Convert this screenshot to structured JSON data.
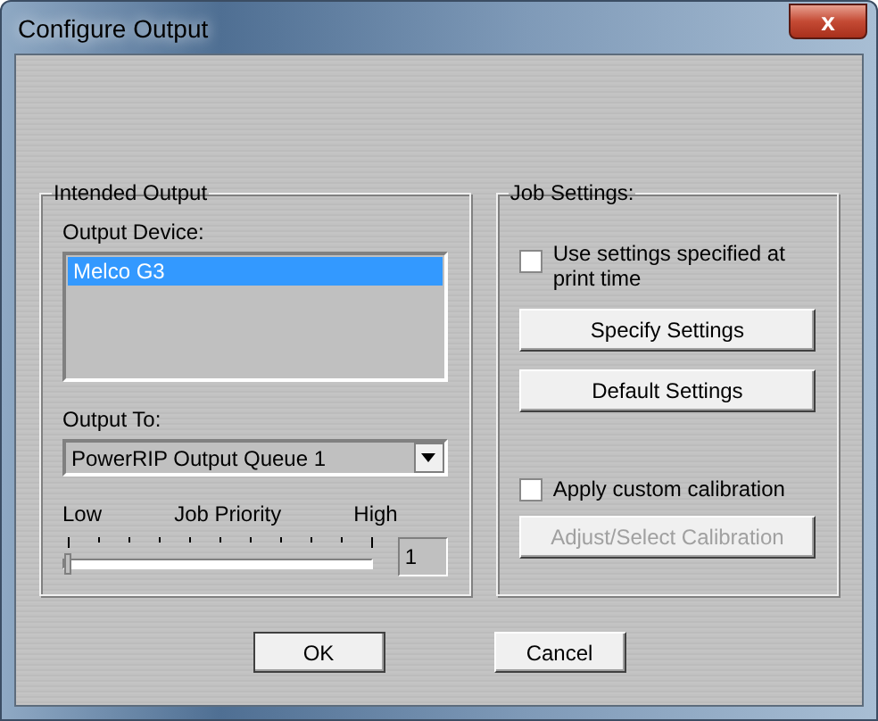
{
  "window": {
    "title": "Configure Output",
    "close_label": "x"
  },
  "intended_output": {
    "title": "Intended Output",
    "device_label": "Output Device:",
    "devices": [
      {
        "name": "Melco G3",
        "selected": true
      }
    ],
    "output_to_label": "Output To:",
    "output_to_value": "PowerRIP Output Queue 1",
    "priority": {
      "low": "Low",
      "title": "Job Priority",
      "high": "High",
      "level": 0,
      "value": "1"
    }
  },
  "job_settings": {
    "title": "Job Settings:",
    "use_print_time": {
      "label": "Use settings specified at print time",
      "checked": false
    },
    "buttons": [
      {
        "label": "Specify Settings",
        "disabled": false
      },
      {
        "label": "Default Settings",
        "disabled": false
      }
    ],
    "custom_calibration": {
      "label": "Apply custom calibration",
      "checked": false
    },
    "calibration_button": {
      "label": "Adjust/Select Calibration",
      "disabled": true
    }
  },
  "buttons": [
    {
      "label": "OK",
      "default": true
    },
    {
      "label": "Cancel",
      "default": false
    }
  ]
}
